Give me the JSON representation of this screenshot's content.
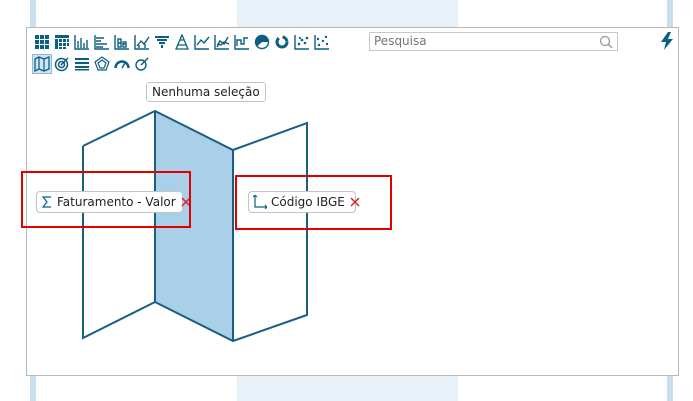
{
  "search": {
    "placeholder": "Pesquisa",
    "value": ""
  },
  "tooltip": {
    "text": "Nenhuma seleção"
  },
  "chips": {
    "measure": {
      "label": "Faturamento - Valor",
      "icon": "sigma-icon"
    },
    "dimension": {
      "label": "Código IBGE",
      "icon": "axis-icon"
    }
  },
  "toolbar": {
    "row1_icons": [
      "table-icon",
      "pivot-table-icon",
      "bar-chart-icon",
      "horizontal-bar-chart-icon",
      "stacked-bar-chart-icon",
      "combo-chart-icon",
      "funnel-icon",
      "pyramid-icon",
      "line-chart-icon",
      "area-chart-icon",
      "step-chart-icon",
      "pie-chart-icon",
      "donut-chart-icon",
      "scatter-chart-icon",
      "bubble-chart-icon"
    ],
    "row2_icons": [
      "map-icon",
      "target-icon",
      "list-icon",
      "radar-icon",
      "gauge-icon",
      "speedometer-icon"
    ],
    "selected": "map-icon"
  },
  "colors": {
    "accent": "#0b5f82",
    "map_fill": "#a9cfe9",
    "highlight": "#e00000",
    "remove": "#d22222"
  }
}
